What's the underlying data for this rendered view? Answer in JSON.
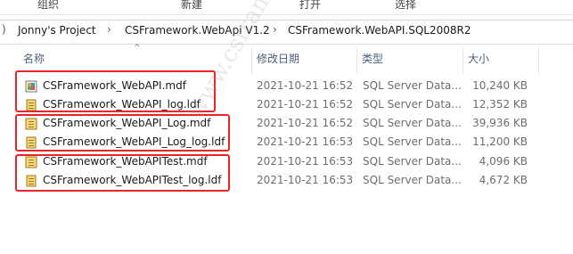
{
  "ribbon": {
    "groups": [
      "组织",
      "新建",
      "打开",
      "选择"
    ]
  },
  "address": {
    "back_glyph": ")",
    "crumbs": [
      "Jonny's Project",
      "CSFramework.WebApi V1.2",
      "CSFramework.WebAPI.SQL2008R2"
    ],
    "separator": "›"
  },
  "columns": {
    "name": "名称",
    "date": "修改日期",
    "type": "类型",
    "size": "大小"
  },
  "files": [
    {
      "name": "CSFramework_WebAPI.mdf",
      "date": "2021-10-21 16:52",
      "type": "SQL Server Data...",
      "size": "10,240 KB",
      "icon": "mdf-database-icon"
    },
    {
      "name": "CSFramework_WebAPI_log.ldf",
      "date": "2021-10-21 16:52",
      "type": "SQL Server Data...",
      "size": "12,352 KB",
      "icon": "ldf-log-icon"
    },
    {
      "name": "CSFramework_WebAPI_Log.mdf",
      "date": "2021-10-21 16:52",
      "type": "SQL Server Data...",
      "size": "39,936 KB",
      "icon": "mdf-database-icon"
    },
    {
      "name": "CSFramework_WebAPI_Log_log.ldf",
      "date": "2021-10-21 16:53",
      "type": "SQL Server Data...",
      "size": "11,200 KB",
      "icon": "ldf-log-icon"
    },
    {
      "name": "CSFramework_WebAPITest.mdf",
      "date": "2021-10-21 16:53",
      "type": "SQL Server Data...",
      "size": "4,096 KB",
      "icon": "mdf-database-icon"
    },
    {
      "name": "CSFramework_WebAPITest_log.ldf",
      "date": "2021-10-21 16:53",
      "type": "SQL Server Data...",
      "size": "4,672 KB",
      "icon": "ldf-log-icon"
    }
  ],
  "colors": {
    "highlight": "#e8262a",
    "header_text": "#4c607a"
  },
  "watermark": "www.csframework.net 开发框架文库"
}
